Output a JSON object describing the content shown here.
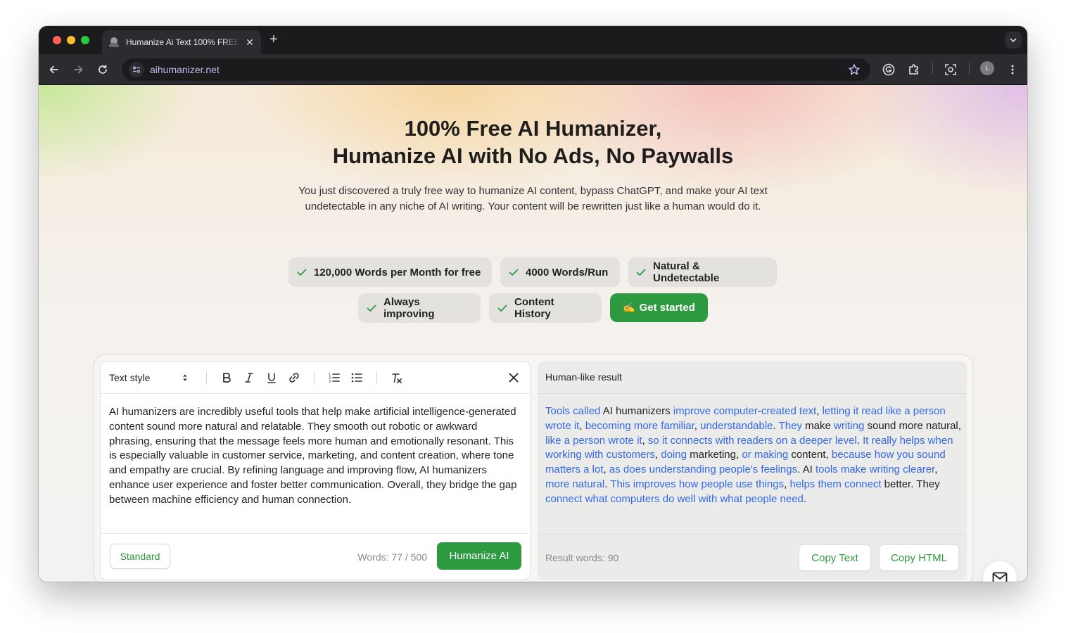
{
  "browser": {
    "tab_title": "Humanize Ai Text 100% FREE",
    "url": "aihumanizer.net",
    "avatar_letter": "L"
  },
  "hero": {
    "headline_line1": "100% Free AI Humanizer,",
    "headline_line2": "Humanize AI with No Ads, No Paywalls",
    "subtitle": "You just discovered a truly free way to humanize AI content, bypass ChatGPT, and make your AI text undetectable in any niche of AI writing. Your content will be rewritten just like a human would do it.",
    "features": [
      "120,000 Words per Month for free",
      "4000 Words/Run",
      "Natural & Undetectable",
      "Always improving",
      "Content History"
    ],
    "cta_label": "Get started",
    "cta_icon": "✍️"
  },
  "editor": {
    "text_style_label": "Text style",
    "input_text": "AI humanizers are incredibly useful tools that help make artificial intelligence-generated content sound more natural and relatable. They smooth out robotic or awkward phrasing, ensuring that the message feels more human and emotionally resonant. This is especially valuable in customer service, marketing, and content creation, where tone and empathy are crucial. By refining language and improving flow, AI humanizers enhance user experience and foster better communication. Overall, they bridge the gap between machine efficiency and human connection.",
    "mode_label": "Standard",
    "word_count": "Words: 77 / 500",
    "humanize_label": "Humanize AI"
  },
  "result": {
    "title": "Human-like result",
    "segments": [
      {
        "t": "Tools called",
        "hl": true
      },
      {
        "t": " AI humanizers ",
        "hl": false
      },
      {
        "t": "improve computer",
        "hl": true
      },
      {
        "t": "-",
        "hl": false
      },
      {
        "t": "created text",
        "hl": true
      },
      {
        "t": ", ",
        "hl": false
      },
      {
        "t": "letting it read like a person wrote it",
        "hl": true
      },
      {
        "t": ", ",
        "hl": false
      },
      {
        "t": "becoming more familiar",
        "hl": true
      },
      {
        "t": ", ",
        "hl": false
      },
      {
        "t": "understandable",
        "hl": true
      },
      {
        "t": ". ",
        "hl": false
      },
      {
        "t": "They",
        "hl": true
      },
      {
        "t": " make ",
        "hl": false
      },
      {
        "t": "writing",
        "hl": true
      },
      {
        "t": " sound more natural, ",
        "hl": false
      },
      {
        "t": "like a person wrote it",
        "hl": true
      },
      {
        "t": ", ",
        "hl": false
      },
      {
        "t": "so it connects with readers on a deeper level",
        "hl": true
      },
      {
        "t": ". ",
        "hl": false
      },
      {
        "t": "It really helps when working with customers",
        "hl": true
      },
      {
        "t": ", ",
        "hl": false
      },
      {
        "t": "doing",
        "hl": true
      },
      {
        "t": " marketing, ",
        "hl": false
      },
      {
        "t": "or making",
        "hl": true
      },
      {
        "t": " content, ",
        "hl": false
      },
      {
        "t": "because how you sound matters a lot",
        "hl": true
      },
      {
        "t": ", ",
        "hl": false
      },
      {
        "t": "as does understanding people's feelings",
        "hl": true
      },
      {
        "t": ". AI ",
        "hl": false
      },
      {
        "t": "tools make writing clearer",
        "hl": true
      },
      {
        "t": ", ",
        "hl": false
      },
      {
        "t": "more natural",
        "hl": true
      },
      {
        "t": ". ",
        "hl": false
      },
      {
        "t": "This improves how people use things",
        "hl": true
      },
      {
        "t": ", ",
        "hl": false
      },
      {
        "t": "helps them connect",
        "hl": true
      },
      {
        "t": " better. They ",
        "hl": false
      },
      {
        "t": "connect what computers do well with what people need",
        "hl": true
      },
      {
        "t": ".",
        "hl": false
      }
    ],
    "result_words": "Result words: 90",
    "copy_text_label": "Copy Text",
    "copy_html_label": "Copy HTML"
  },
  "colors": {
    "brand_green": "#2e9a3f",
    "highlight_blue": "#3369e8"
  }
}
